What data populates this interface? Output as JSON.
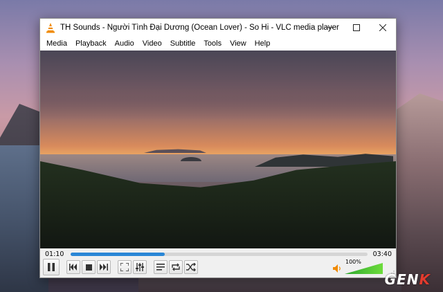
{
  "window": {
    "title": "TH Sounds - Người Tình Đại Dương (Ocean Lover) - So Hi - VLC media player"
  },
  "menu": [
    "Media",
    "Playback",
    "Audio",
    "Video",
    "Subtitle",
    "Tools",
    "View",
    "Help"
  ],
  "player": {
    "elapsed": "01:10",
    "total": "03:40",
    "progress": 0.318,
    "volume_label": "100%",
    "volume_level": 1.0
  },
  "watermark": {
    "text_a": "GEN",
    "text_b": "K"
  },
  "colors": {
    "accent": "#2a87d6",
    "volume": "#4cc234",
    "vlc_orange": "#f08a00"
  }
}
